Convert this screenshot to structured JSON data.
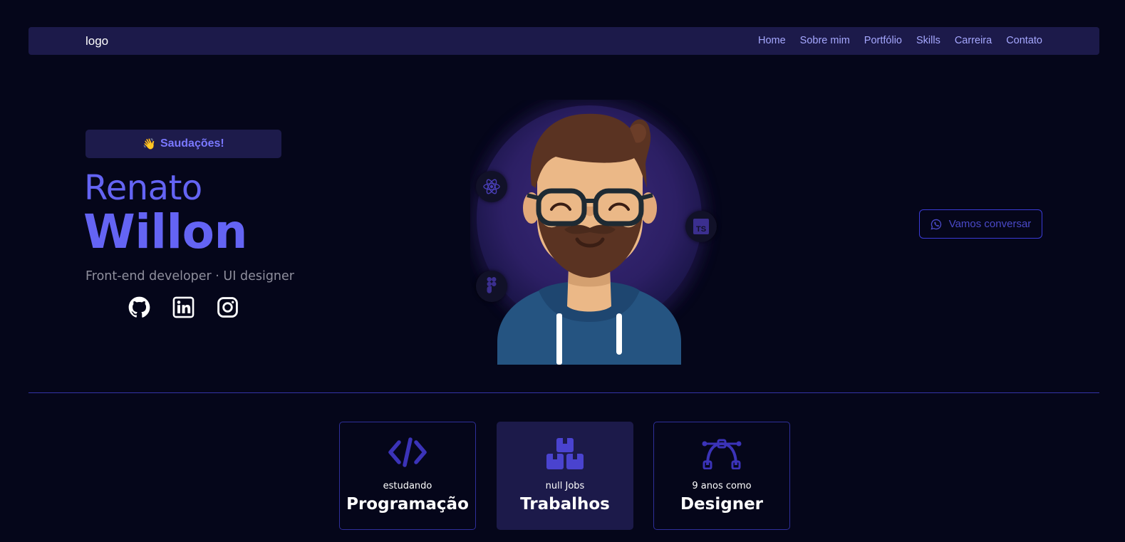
{
  "nav": {
    "logo": "logo",
    "links": [
      "Home",
      "Sobre mim",
      "Portfólio",
      "Skills",
      "Carreira",
      "Contato"
    ]
  },
  "hero": {
    "greeting_emoji": "👋",
    "greeting": "Saudações!",
    "first_name": "Renato",
    "last_name": "Willon",
    "role": "Front-end developer · UI designer",
    "socials": [
      "github-icon",
      "linkedin-icon",
      "instagram-icon"
    ],
    "tech_icons": [
      "react-icon",
      "typescript-icon",
      "figma-icon"
    ],
    "ts_label": "TS"
  },
  "cta": {
    "label": "Vamos conversar",
    "icon": "whatsapp-icon"
  },
  "cards": [
    {
      "icon": "code-icon",
      "small": "estudando",
      "big": "Programação"
    },
    {
      "icon": "boxes-icon",
      "small": "null Jobs",
      "big": "Trabalhos"
    },
    {
      "icon": "bezier-icon",
      "small": "9 anos como",
      "big": "Designer"
    }
  ],
  "colors": {
    "background": "#05061a",
    "navbar": "#1c1a4a",
    "accent": "#6464f4",
    "nav_link": "#a6a8ff",
    "card_border": "#2f2f9a"
  }
}
